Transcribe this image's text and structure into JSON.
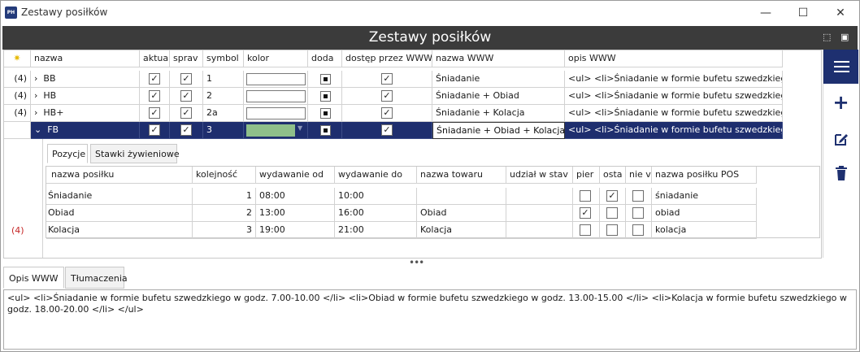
{
  "window": {
    "title": "Zestawy posiłków",
    "app_icon": "PH"
  },
  "header": {
    "title": "Zestawy posiłków"
  },
  "grid": {
    "columns": [
      "nazwa",
      "aktua",
      "sprav",
      "symbol",
      "kolor",
      "doda",
      "dostęp przez WWW",
      "nazwa WWW",
      "opis WWW"
    ],
    "rows": [
      {
        "count": "(4)",
        "expander": "›",
        "name": "BB",
        "active": "✓",
        "spr": "✓",
        "symbol": "1",
        "added": true,
        "www": "✓",
        "name_www": "Śniadanie",
        "desc_www": "<ul> <li>Śniadanie w formie bufetu szwedzkiego w"
      },
      {
        "count": "(4)",
        "expander": "›",
        "name": "HB",
        "active": "✓",
        "spr": "✓",
        "symbol": "2",
        "added": true,
        "www": "✓",
        "name_www": "Śniadanie + Obiad",
        "desc_www": "<ul> <li>Śniadanie w formie bufetu szwedzkiego w"
      },
      {
        "count": "(4)",
        "expander": "›",
        "name": "HB+",
        "active": "✓",
        "spr": "✓",
        "symbol": "2a",
        "added": true,
        "www": "✓",
        "name_www": "Śniadanie + Kolacja",
        "desc_www": "<ul> <li>Śniadanie w formie bufetu szwedzkiego w"
      },
      {
        "count": "(4)",
        "expander": "⌄",
        "name": "FB",
        "active": "✓",
        "spr": "✓",
        "symbol": "3",
        "added": true,
        "www": "✓",
        "name_www": "Śniadanie + Obiad + Kolacja",
        "desc_www": "<ul> <li>Śniadanie w formie bufetu szwedzkiego w"
      }
    ],
    "selected_color": "#8fbf8a"
  },
  "detail": {
    "tabs": [
      "Pozycje",
      "Stawki żywieniowe"
    ],
    "columns": [
      "nazwa posiłku",
      "kolejność",
      "wydawanie od",
      "wydawanie do",
      "nazwa towaru",
      "udział w stav",
      "pier",
      "osta",
      "nie v",
      "nazwa posiłku POS"
    ],
    "rows": [
      {
        "name": "Śniadanie",
        "order": "1",
        "from": "08:00",
        "to": "10:00",
        "product": "",
        "share": "",
        "first": "",
        "last": "✓",
        "not": "",
        "pos": "śniadanie"
      },
      {
        "name": "Obiad",
        "order": "2",
        "from": "13:00",
        "to": "16:00",
        "product": "Obiad",
        "share": "",
        "first": "✓",
        "last": "",
        "not": "",
        "pos": "obiad"
      },
      {
        "name": "Kolacja",
        "order": "3",
        "from": "19:00",
        "to": "21:00",
        "product": "Kolacja",
        "share": "",
        "first": "",
        "last": "",
        "not": "",
        "pos": "kolacja"
      }
    ]
  },
  "bottom": {
    "tabs": [
      "Opis WWW",
      "Tłumaczenia"
    ],
    "memo": "<ul> <li>Śniadanie w formie bufetu szwedzkiego w godz. 7.00-10.00 </li> <li>Obiad w formie bufetu szwedzkiego w godz. 13.00-15.00 </li> <li>Kolacja w formie bufetu szwedzkiego w godz. 18.00-20.00 </li> </ul>"
  },
  "icons": {
    "minimize": "minimize-icon",
    "maximize": "maximize-icon",
    "close": "close-icon",
    "menu": "hamburger-icon",
    "add": "plus-icon",
    "edit": "edit-icon",
    "delete": "trash-icon"
  }
}
